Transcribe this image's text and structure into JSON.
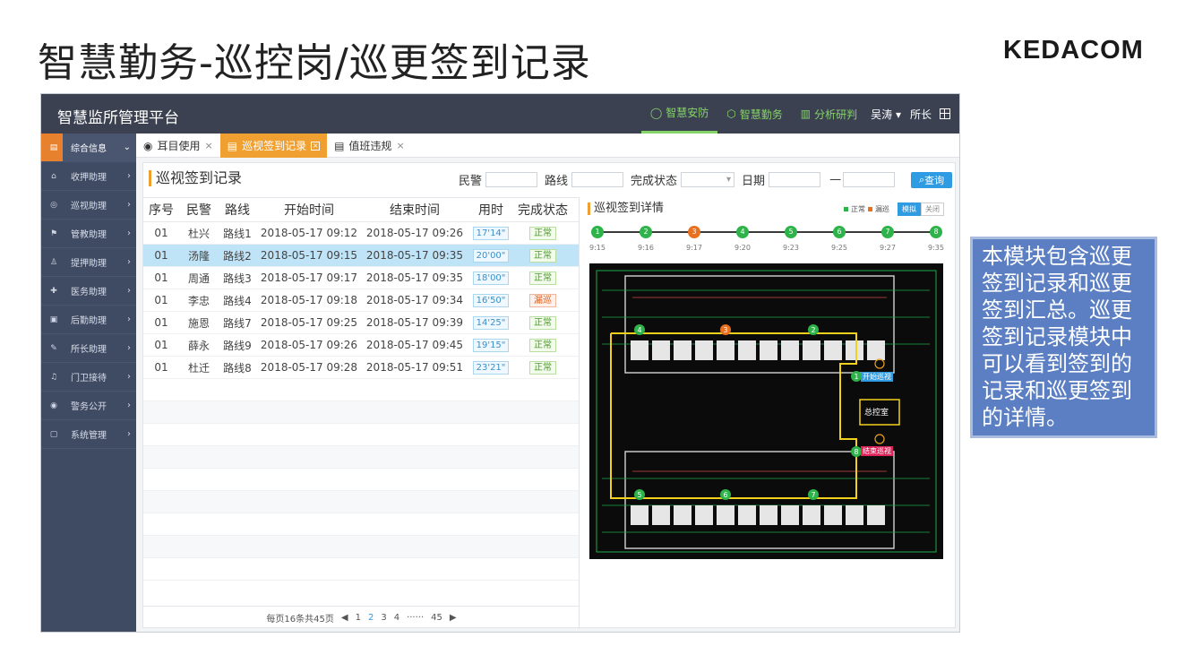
{
  "slide": {
    "title": "智慧勤务-巡控岗/巡更签到记录",
    "brand": "KEDACOM"
  },
  "topbar": {
    "platform": "智慧监所管理平台",
    "nav": [
      {
        "label": "智慧安防",
        "icon": "circle-icon"
      },
      {
        "label": "智慧勤务",
        "icon": "cube-icon"
      },
      {
        "label": "分析研判",
        "icon": "bar-chart-icon"
      }
    ],
    "user": "吴涛 ▾",
    "role": "所长"
  },
  "sidebar": {
    "items": [
      {
        "label": "综合信息",
        "icon": "document-icon",
        "arrow": "⌄"
      },
      {
        "label": "收押助理",
        "icon": "gate-icon",
        "arrow": "›"
      },
      {
        "label": "巡视助理",
        "icon": "camera-icon",
        "arrow": "›"
      },
      {
        "label": "管教助理",
        "icon": "flag-icon",
        "arrow": "›"
      },
      {
        "label": "提押助理",
        "icon": "person-icon",
        "arrow": "›"
      },
      {
        "label": "医务助理",
        "icon": "medical-icon",
        "arrow": "›"
      },
      {
        "label": "后勤助理",
        "icon": "bag-icon",
        "arrow": "›"
      },
      {
        "label": "所长助理",
        "icon": "pen-icon",
        "arrow": "›"
      },
      {
        "label": "门卫接待",
        "icon": "bell-icon",
        "arrow": "›"
      },
      {
        "label": "警务公开",
        "icon": "globe-icon",
        "arrow": "›"
      },
      {
        "label": "系统管理",
        "icon": "window-icon",
        "arrow": "›"
      }
    ]
  },
  "tabs": [
    {
      "label": "耳目使用",
      "icon": "eye-icon",
      "close": "×"
    },
    {
      "label": "巡视签到记录",
      "icon": "list-icon",
      "close": "×"
    },
    {
      "label": "值班违规",
      "icon": "list-icon",
      "close": "×"
    }
  ],
  "page": {
    "title": "巡视签到记录"
  },
  "filters": {
    "police_label": "民警",
    "route_label": "路线",
    "status_label": "完成状态",
    "date_label": "日期",
    "date_sep": "—",
    "query_label": "查询",
    "query_icon": "search-icon"
  },
  "table": {
    "headers": [
      "序号",
      "民警",
      "路线",
      "开始时间",
      "结束时间",
      "用时",
      "完成状态"
    ],
    "rows": [
      {
        "no": "01",
        "officer": "杜兴",
        "route": "路线1",
        "start": "2018-05-17 09:12",
        "end": "2018-05-17 09:26",
        "duration": "17'14\"",
        "status": "正常"
      },
      {
        "no": "01",
        "officer": "汤隆",
        "route": "路线2",
        "start": "2018-05-17 09:15",
        "end": "2018-05-17 09:35",
        "duration": "20'00\"",
        "status": "正常"
      },
      {
        "no": "01",
        "officer": "周通",
        "route": "路线3",
        "start": "2018-05-17 09:17",
        "end": "2018-05-17 09:35",
        "duration": "18'00\"",
        "status": "正常"
      },
      {
        "no": "01",
        "officer": "李忠",
        "route": "路线4",
        "start": "2018-05-17 09:18",
        "end": "2018-05-17 09:34",
        "duration": "16'50\"",
        "status": "漏巡"
      },
      {
        "no": "01",
        "officer": "施恩",
        "route": "路线7",
        "start": "2018-05-17 09:25",
        "end": "2018-05-17 09:39",
        "duration": "14'25\"",
        "status": "正常"
      },
      {
        "no": "01",
        "officer": "薛永",
        "route": "路线9",
        "start": "2018-05-17 09:26",
        "end": "2018-05-17 09:45",
        "duration": "19'15\"",
        "status": "正常"
      },
      {
        "no": "01",
        "officer": "杜迁",
        "route": "路线8",
        "start": "2018-05-17 09:28",
        "end": "2018-05-17 09:51",
        "duration": "23'21\"",
        "status": "正常"
      }
    ],
    "selected_index": 1
  },
  "pager": {
    "summary": "每页16条共45页",
    "prev": "◀",
    "pages": [
      "1",
      "2",
      "3",
      "4",
      "······",
      "45"
    ],
    "current": "2",
    "next": "▶"
  },
  "detail": {
    "title": "巡视签到详情",
    "legend_normal": "正常",
    "legend_missed": "漏巡",
    "legend_normal_color": "#2db34a",
    "legend_missed_color": "#e8701e",
    "toggle_on": "模拟",
    "toggle_off": "关闭",
    "checkpoints": [
      {
        "label": "1",
        "time": "9:15",
        "status": "normal"
      },
      {
        "label": "2",
        "time": "9:16",
        "status": "normal"
      },
      {
        "label": "3",
        "time": "9:17",
        "status": "missed"
      },
      {
        "label": "4",
        "time": "9:20",
        "status": "normal"
      },
      {
        "label": "5",
        "time": "9:23",
        "status": "normal"
      },
      {
        "label": "6",
        "time": "9:25",
        "status": "normal"
      },
      {
        "label": "7",
        "time": "9:27",
        "status": "normal"
      },
      {
        "label": "8",
        "time": "9:35",
        "status": "normal"
      }
    ],
    "map": {
      "start_label": "开始巡视",
      "end_label": "结束巡视",
      "control_room": "总控室",
      "markers": [
        "4",
        "3",
        "2",
        "1",
        "8",
        "5",
        "6",
        "7"
      ]
    }
  },
  "note": {
    "text": "本模块包含巡更签到记录和巡更签到汇总。巡更签到记录模块中可以看到签到的记录和巡更签到的详情。"
  }
}
